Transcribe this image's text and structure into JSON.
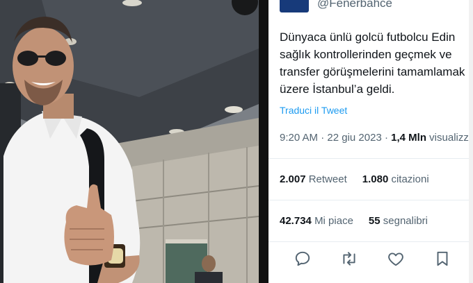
{
  "tweet": {
    "handle": "@Fenerbahce",
    "text_lines": [
      "Dünyaca ünlü golcü futbolcu Edin",
      "sağlık kontrollerinden geçmek ve",
      "transfer görüşmelerini tamamlamak",
      "üzere İstanbul’a geldi."
    ],
    "translate_label": "Traduci il Tweet",
    "time": "9:20 AM",
    "date": "22 giu 2023",
    "views_count": "1,4 Mln",
    "views_label": "visualizzazioni",
    "retweets_count": "2.007",
    "retweets_label": "Retweet",
    "quotes_count": "1.080",
    "quotes_label": "citazioni",
    "likes_count": "42.734",
    "likes_label": "Mi piace",
    "bookmarks_count": "55",
    "bookmarks_label": "segnalibri"
  },
  "icons": {
    "more": "more-icon",
    "reply": "reply-icon",
    "retweet": "retweet-icon",
    "like": "heart-icon",
    "bookmark": "bookmark-icon"
  },
  "colors": {
    "link": "#1d9bf0",
    "muted": "#536471",
    "text": "#0f1419",
    "brand_avatar": "#173a7a"
  }
}
